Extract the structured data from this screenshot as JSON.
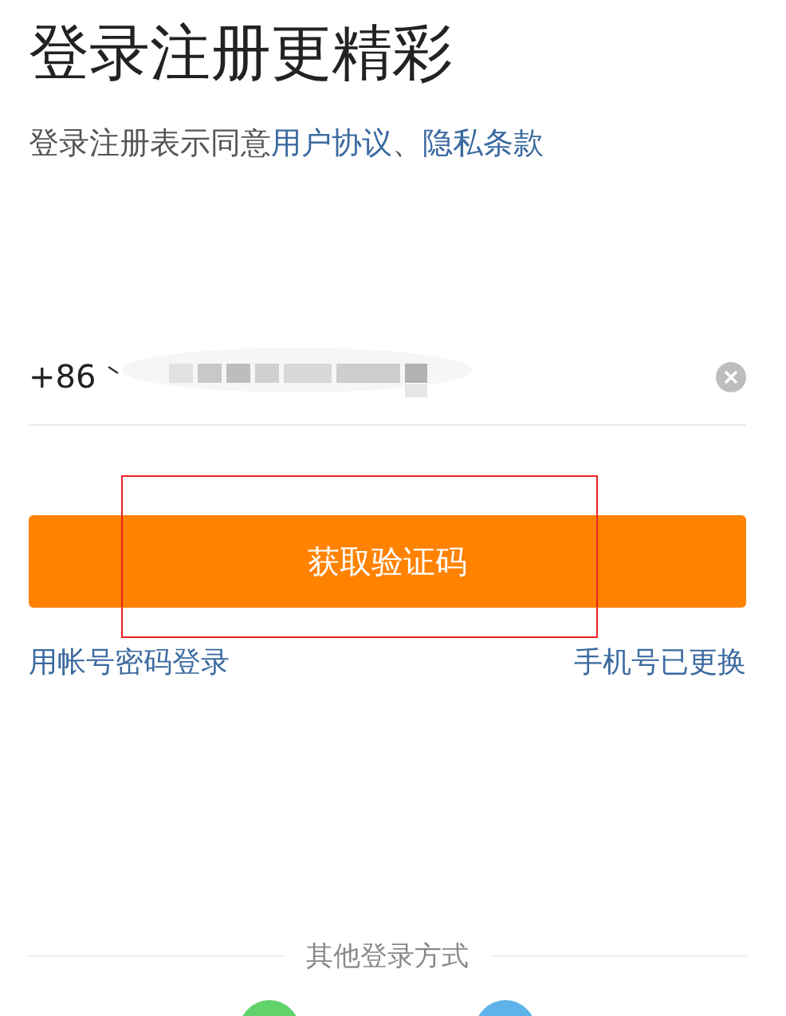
{
  "title": "登录注册更精彩",
  "agreement": {
    "prefix": "登录注册表示同意",
    "links": [
      "用户协议",
      "隐私条款"
    ],
    "separator": "、"
  },
  "phone_field": {
    "country_code": "+86"
  },
  "submit_button": "获取验证码",
  "links": [
    "用帐号密码登录",
    "手机号已更换"
  ],
  "other_login": {
    "label": "其他登录方式",
    "options": [
      {
        "color": "#62d36a"
      },
      {
        "color": "#5fb3ea"
      }
    ]
  }
}
